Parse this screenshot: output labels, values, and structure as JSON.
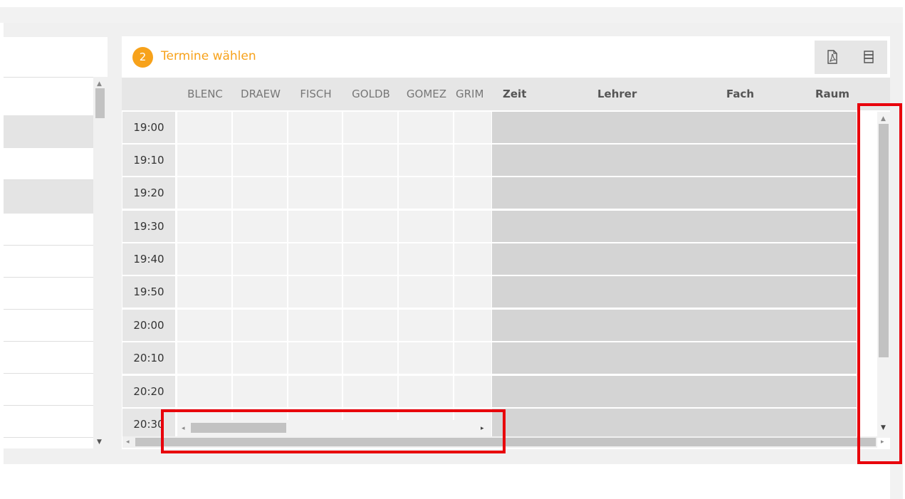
{
  "step": {
    "number": "2",
    "title": "Termine wählen"
  },
  "toolbar": {
    "icons": [
      "pdf-icon",
      "print-layout-icon"
    ]
  },
  "grid": {
    "teacher_columns": [
      "BLENC",
      "DRAEW",
      "FISCH",
      "GOLDB",
      "GOMEZ",
      "GRIM"
    ],
    "detail_headers": {
      "time": "Zeit",
      "teacher": "Lehrer",
      "subject": "Fach",
      "room": "Raum"
    },
    "times": [
      "19:00",
      "19:10",
      "19:20",
      "19:30",
      "19:40",
      "19:50",
      "20:00",
      "20:10",
      "20:20",
      "20:30"
    ]
  },
  "scroll": {
    "up_arrow": "▲",
    "down_arrow": "▼",
    "left_arrow": "◂",
    "right_arrow": "▸"
  },
  "colors": {
    "accent": "#f7a21b",
    "highlight": "#e8000b",
    "header_bg": "#e6e6e6",
    "detail_row_bg": "#d4d4d4"
  }
}
